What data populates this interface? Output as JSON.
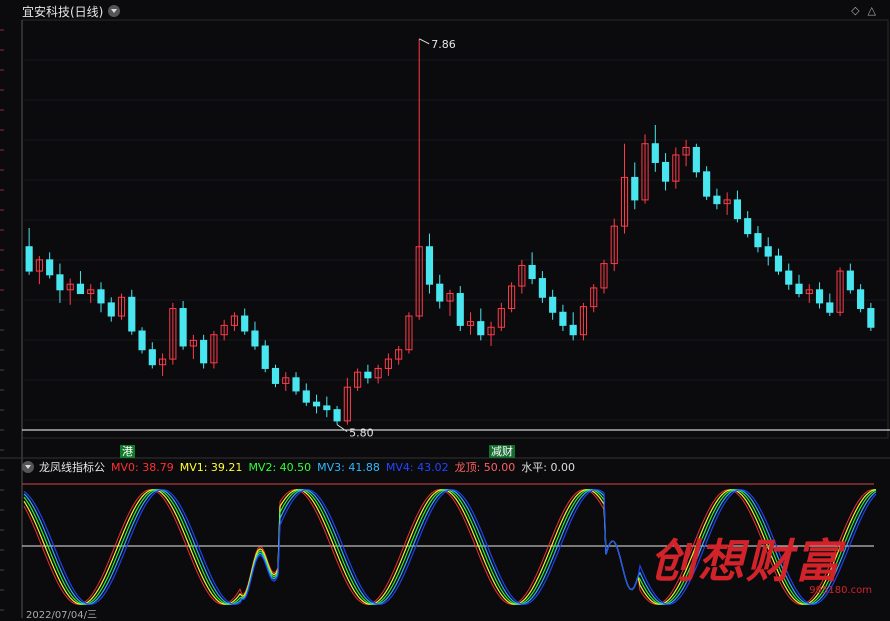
{
  "window": {
    "title": "宜安科技(日线)"
  },
  "price_chart": {
    "high_label": "7.86",
    "low_label": "5.80",
    "colors": {
      "up": "#ff3b4a",
      "down": "#49e6f0",
      "hline": "#ffffff",
      "bg": "#0b0b0d"
    }
  },
  "tags": [
    {
      "text": "港"
    },
    {
      "text": "减财"
    }
  ],
  "indicator": {
    "name": "龙凤线指标公",
    "items": [
      {
        "label": "MV0:",
        "value": "38.79",
        "color": "#ff3030"
      },
      {
        "label": "MV1:",
        "value": "39.21",
        "color": "#ffff33"
      },
      {
        "label": "MV2:",
        "value": "40.50",
        "color": "#33ff33"
      },
      {
        "label": "MV3:",
        "value": "41.88",
        "color": "#33b8ff"
      },
      {
        "label": "MV4:",
        "value": "43.02",
        "color": "#2244ff"
      },
      {
        "label": "龙顶:",
        "value": "50.00",
        "color": "#ff6060"
      },
      {
        "label": "水平:",
        "value": "0.00",
        "color": "#dddddd"
      }
    ]
  },
  "bottom_date": "2022/07/04/三",
  "watermark": {
    "text": "创想财富",
    "url": "995180.com"
  },
  "chart_data": {
    "type": "candlestick",
    "title": "宜安科技(日线)",
    "max_label": "7.86",
    "min_label": "5.80",
    "y_range": [
      5.75,
      7.95
    ],
    "candles": [
      [
        6.75,
        6.85,
        6.6,
        6.62
      ],
      [
        6.62,
        6.7,
        6.55,
        6.68
      ],
      [
        6.68,
        6.72,
        6.58,
        6.6
      ],
      [
        6.6,
        6.66,
        6.45,
        6.52
      ],
      [
        6.52,
        6.58,
        6.44,
        6.55
      ],
      [
        6.55,
        6.62,
        6.5,
        6.5
      ],
      [
        6.5,
        6.55,
        6.45,
        6.52
      ],
      [
        6.52,
        6.56,
        6.4,
        6.45
      ],
      [
        6.45,
        6.48,
        6.35,
        6.38
      ],
      [
        6.38,
        6.5,
        6.36,
        6.48
      ],
      [
        6.48,
        6.52,
        6.28,
        6.3
      ],
      [
        6.3,
        6.32,
        6.18,
        6.2
      ],
      [
        6.2,
        6.24,
        6.1,
        6.12
      ],
      [
        6.12,
        6.18,
        6.06,
        6.15
      ],
      [
        6.15,
        6.45,
        6.12,
        6.42
      ],
      [
        6.42,
        6.46,
        6.2,
        6.22
      ],
      [
        6.22,
        6.28,
        6.15,
        6.25
      ],
      [
        6.25,
        6.28,
        6.1,
        6.13
      ],
      [
        6.13,
        6.3,
        6.1,
        6.28
      ],
      [
        6.28,
        6.36,
        6.25,
        6.33
      ],
      [
        6.33,
        6.4,
        6.3,
        6.38
      ],
      [
        6.38,
        6.42,
        6.28,
        6.3
      ],
      [
        6.3,
        6.35,
        6.2,
        6.22
      ],
      [
        6.22,
        6.25,
        6.08,
        6.1
      ],
      [
        6.1,
        6.12,
        6.0,
        6.02
      ],
      [
        6.02,
        6.08,
        5.98,
        6.05
      ],
      [
        6.05,
        6.08,
        5.96,
        5.98
      ],
      [
        5.98,
        6.02,
        5.9,
        5.92
      ],
      [
        5.92,
        5.96,
        5.86,
        5.9
      ],
      [
        5.9,
        5.95,
        5.84,
        5.88
      ],
      [
        5.88,
        5.9,
        5.8,
        5.82
      ],
      [
        5.82,
        6.05,
        5.8,
        6.0
      ],
      [
        6.0,
        6.1,
        5.98,
        6.08
      ],
      [
        6.08,
        6.12,
        6.02,
        6.05
      ],
      [
        6.05,
        6.12,
        6.02,
        6.1
      ],
      [
        6.1,
        6.18,
        6.06,
        6.15
      ],
      [
        6.15,
        6.22,
        6.12,
        6.2
      ],
      [
        6.2,
        6.4,
        6.18,
        6.38
      ],
      [
        6.38,
        7.86,
        6.36,
        6.75
      ],
      [
        6.75,
        6.82,
        6.5,
        6.55
      ],
      [
        6.55,
        6.6,
        6.42,
        6.46
      ],
      [
        6.46,
        6.52,
        6.38,
        6.5
      ],
      [
        6.5,
        6.54,
        6.3,
        6.33
      ],
      [
        6.33,
        6.4,
        6.28,
        6.35
      ],
      [
        6.35,
        6.42,
        6.25,
        6.28
      ],
      [
        6.28,
        6.35,
        6.22,
        6.32
      ],
      [
        6.32,
        6.45,
        6.3,
        6.42
      ],
      [
        6.42,
        6.56,
        6.4,
        6.54
      ],
      [
        6.54,
        6.68,
        6.5,
        6.65
      ],
      [
        6.65,
        6.72,
        6.55,
        6.58
      ],
      [
        6.58,
        6.62,
        6.45,
        6.48
      ],
      [
        6.48,
        6.52,
        6.36,
        6.4
      ],
      [
        6.4,
        6.44,
        6.3,
        6.33
      ],
      [
        6.33,
        6.4,
        6.25,
        6.28
      ],
      [
        6.28,
        6.45,
        6.25,
        6.43
      ],
      [
        6.43,
        6.55,
        6.4,
        6.53
      ],
      [
        6.53,
        6.68,
        6.5,
        6.66
      ],
      [
        6.66,
        6.9,
        6.62,
        6.86
      ],
      [
        6.86,
        7.3,
        6.82,
        7.12
      ],
      [
        7.12,
        7.2,
        6.95,
        7.0
      ],
      [
        7.0,
        7.35,
        6.98,
        7.3
      ],
      [
        7.3,
        7.4,
        7.15,
        7.2
      ],
      [
        7.2,
        7.25,
        7.05,
        7.1
      ],
      [
        7.1,
        7.28,
        7.06,
        7.24
      ],
      [
        7.24,
        7.32,
        7.18,
        7.28
      ],
      [
        7.28,
        7.3,
        7.12,
        7.15
      ],
      [
        7.15,
        7.18,
        7.0,
        7.02
      ],
      [
        7.02,
        7.06,
        6.95,
        6.98
      ],
      [
        6.98,
        7.04,
        6.92,
        7.0
      ],
      [
        7.0,
        7.05,
        6.88,
        6.9
      ],
      [
        6.9,
        6.94,
        6.8,
        6.82
      ],
      [
        6.82,
        6.86,
        6.72,
        6.75
      ],
      [
        6.75,
        6.8,
        6.65,
        6.7
      ],
      [
        6.7,
        6.74,
        6.6,
        6.62
      ],
      [
        6.62,
        6.66,
        6.52,
        6.55
      ],
      [
        6.55,
        6.6,
        6.48,
        6.5
      ],
      [
        6.5,
        6.55,
        6.45,
        6.52
      ],
      [
        6.52,
        6.56,
        6.42,
        6.45
      ],
      [
        6.45,
        6.5,
        6.38,
        6.4
      ],
      [
        6.4,
        6.64,
        6.38,
        6.62
      ],
      [
        6.62,
        6.66,
        6.5,
        6.52
      ],
      [
        6.52,
        6.55,
        6.4,
        6.42
      ],
      [
        6.42,
        6.45,
        6.3,
        6.32
      ]
    ],
    "indicator_series": [
      {
        "name": "MV0",
        "color": "#ff3030"
      },
      {
        "name": "MV1",
        "color": "#ffff33"
      },
      {
        "name": "MV2",
        "color": "#33ff33"
      },
      {
        "name": "MV3",
        "color": "#33b8ff"
      },
      {
        "name": "MV4",
        "color": "#2244ff"
      }
    ],
    "indicator_range": [
      0,
      50
    ],
    "reference_lines": {
      "龙顶": 50.0,
      "水平": 0.0
    }
  }
}
